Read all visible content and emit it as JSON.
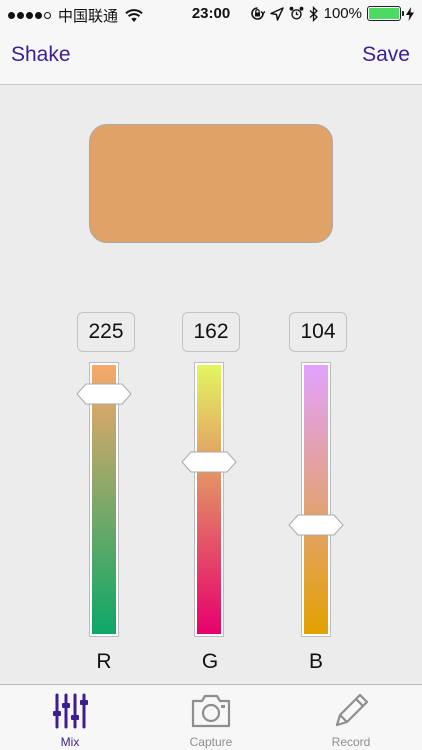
{
  "status_bar": {
    "carrier": "中国联通",
    "time": "23:00",
    "battery_percent": "100%",
    "signal_bars": 4,
    "signal_total": 5
  },
  "nav": {
    "left_label": "Shake",
    "right_label": "Save",
    "tint_color": "#3c1e92"
  },
  "swatch": {
    "color": "#e1a268"
  },
  "channels": [
    {
      "label": "R",
      "value": "225",
      "fraction": 0.882,
      "gradient_top": "#f8a86a",
      "gradient_bottom": "#0ca868"
    },
    {
      "label": "G",
      "value": "162",
      "fraction": 0.635,
      "gradient_top": "#e2f660",
      "gradient_bottom": "#e6006c"
    },
    {
      "label": "B",
      "value": "104",
      "fraction": 0.408,
      "gradient_top": "#e2a2ff",
      "gradient_bottom": "#e2a200"
    }
  ],
  "tabs": [
    {
      "label": "Mix",
      "icon": "sliders-icon",
      "active": true
    },
    {
      "label": "Capture",
      "icon": "camera-icon",
      "active": false
    },
    {
      "label": "Record",
      "icon": "pencil-icon",
      "active": false
    }
  ]
}
